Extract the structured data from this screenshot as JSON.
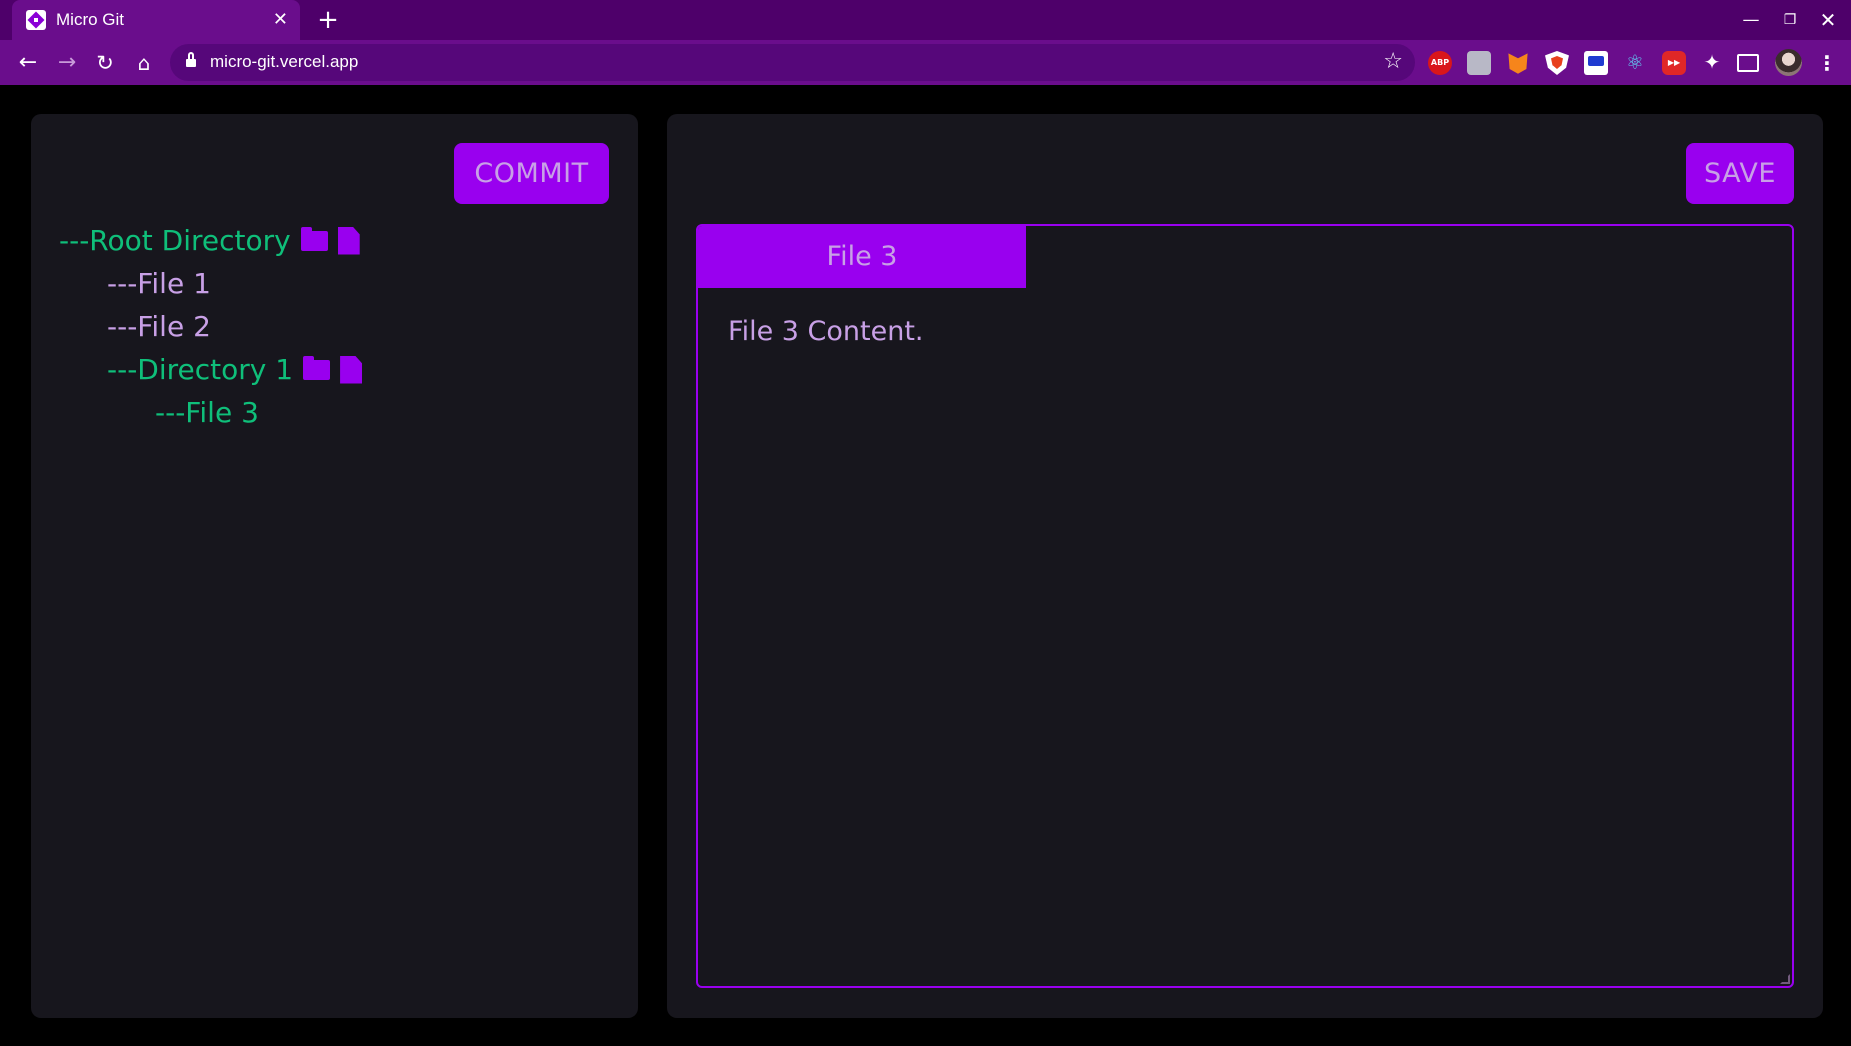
{
  "browser": {
    "tab_title": "Micro Git",
    "tab_close": "✕",
    "new_tab": "+",
    "url": "micro-git.vercel.app",
    "window_controls": {
      "minimize": "—",
      "maximize": "❐",
      "close": "✕"
    },
    "extensions": [
      {
        "name": "adblock-plus-icon",
        "label": "ABP"
      },
      {
        "name": "camera-icon",
        "label": ""
      },
      {
        "name": "metamask-fox-icon",
        "label": ""
      },
      {
        "name": "shield-icon",
        "label": ""
      },
      {
        "name": "screen-icon",
        "label": ""
      },
      {
        "name": "react-devtools-icon",
        "label": "⚛"
      },
      {
        "name": "youtube-icon",
        "label": "▶▶"
      },
      {
        "name": "extensions-puzzle-icon",
        "label": "✦"
      }
    ]
  },
  "app": {
    "commit_label": "COMMIT",
    "save_label": "SAVE",
    "tree": [
      {
        "label": "---Root Directory",
        "type": "directory",
        "depth": 0,
        "active": false
      },
      {
        "label": "---File 1",
        "type": "file",
        "depth": 1,
        "active": false
      },
      {
        "label": "---File 2",
        "type": "file",
        "depth": 1,
        "active": false
      },
      {
        "label": "---Directory 1",
        "type": "directory",
        "depth": 1,
        "active": false
      },
      {
        "label": "---File 3",
        "type": "file",
        "depth": 2,
        "active": true
      }
    ],
    "editor": {
      "tab_label": "File 3",
      "content": "File 3 Content."
    },
    "colors": {
      "accent": "#9900ef",
      "directory_text": "#0fbf7a",
      "file_text": "#c8a0e6",
      "panel_bg": "#17161d",
      "browser_frame": "#6a0d8c"
    }
  }
}
